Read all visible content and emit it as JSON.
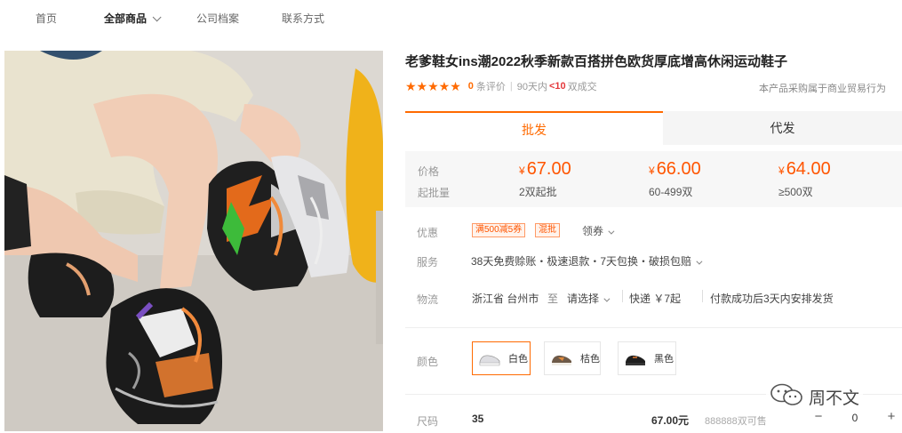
{
  "nav": {
    "items": [
      {
        "label": "首页"
      },
      {
        "label": "全部商品"
      },
      {
        "label": "公司档案"
      },
      {
        "label": "联系方式"
      }
    ]
  },
  "product": {
    "title": "老爹鞋女ins潮2022秋季新款百搭拼色欧货厚底增高休闲运动鞋子",
    "stars": "★★★★★",
    "review_count": "0",
    "review_label": "条评价",
    "sold_period": "90天内",
    "sold_count": "<10",
    "sold_label": "双成交",
    "notice": "本产品采购属于商业贸易行为"
  },
  "tabs": [
    {
      "label": "批发"
    },
    {
      "label": "代发"
    }
  ],
  "pricing": {
    "price_label": "价格",
    "min_label": "起批量",
    "currency": "¥",
    "tiers": [
      {
        "price": "67.00",
        "range": "2双起批"
      },
      {
        "price": "66.00",
        "range": "60-499双"
      },
      {
        "price": "64.00",
        "range": "≥500双"
      }
    ]
  },
  "promo": {
    "label": "优惠",
    "tags": [
      "满500减5券",
      "混批"
    ],
    "coupon": "领券"
  },
  "service": {
    "label": "服务",
    "text": "38天免费赊账・极速退款・7天包换・破损包赔"
  },
  "logistics": {
    "label": "物流",
    "origin": "浙江省 台州市",
    "to": "至",
    "destination": "请选择",
    "express": "快递 ￥7起",
    "note": "付款成功后3天内安排发货"
  },
  "colors": {
    "label": "颜色",
    "options": [
      {
        "label": "白色",
        "swatch": "#e8e8ea"
      },
      {
        "label": "桔色",
        "swatch": "#8a7a6c"
      },
      {
        "label": "黑色",
        "swatch": "#2a2a2a"
      }
    ],
    "selected_index": 0
  },
  "size": {
    "label": "尺码",
    "value": "35",
    "price": "67.00元",
    "stock": "888888双可售",
    "quantity": "0",
    "minus": "−",
    "plus": "+"
  },
  "watermark": {
    "text": "周不文"
  },
  "theme": {
    "accent": "#ff6a00",
    "price": "#ff5500"
  }
}
